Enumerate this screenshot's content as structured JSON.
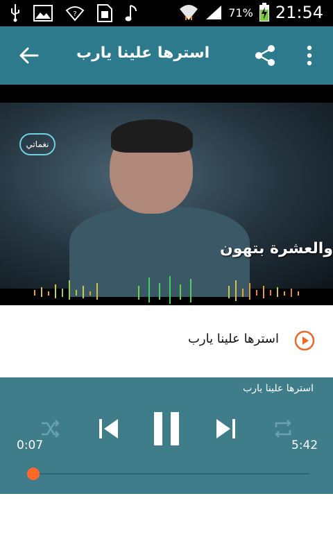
{
  "status_bar": {
    "clock": "21:54",
    "battery_percent": "71%",
    "icons": [
      "usb-icon",
      "image-icon",
      "wifi-question-icon",
      "sim-card-icon",
      "music-note-icon",
      "wifi-icon",
      "signal-icon",
      "battery-charging-icon"
    ]
  },
  "app_bar": {
    "title": "استرها علينا يارب",
    "icons": [
      "back-arrow-icon",
      "share-icon",
      "more-vert-icon"
    ]
  },
  "video": {
    "caption": "والعشرة بتهون",
    "logo_text": "نغماتي"
  },
  "track": {
    "title": "استرها علينا يارب"
  },
  "player": {
    "now_playing_title": "استرها علينا يارب",
    "elapsed": "0:07",
    "total": "5:42",
    "progress_fraction": 0.02,
    "accent_color": "#ff6a2b",
    "background_color": "#3f7d8b"
  }
}
